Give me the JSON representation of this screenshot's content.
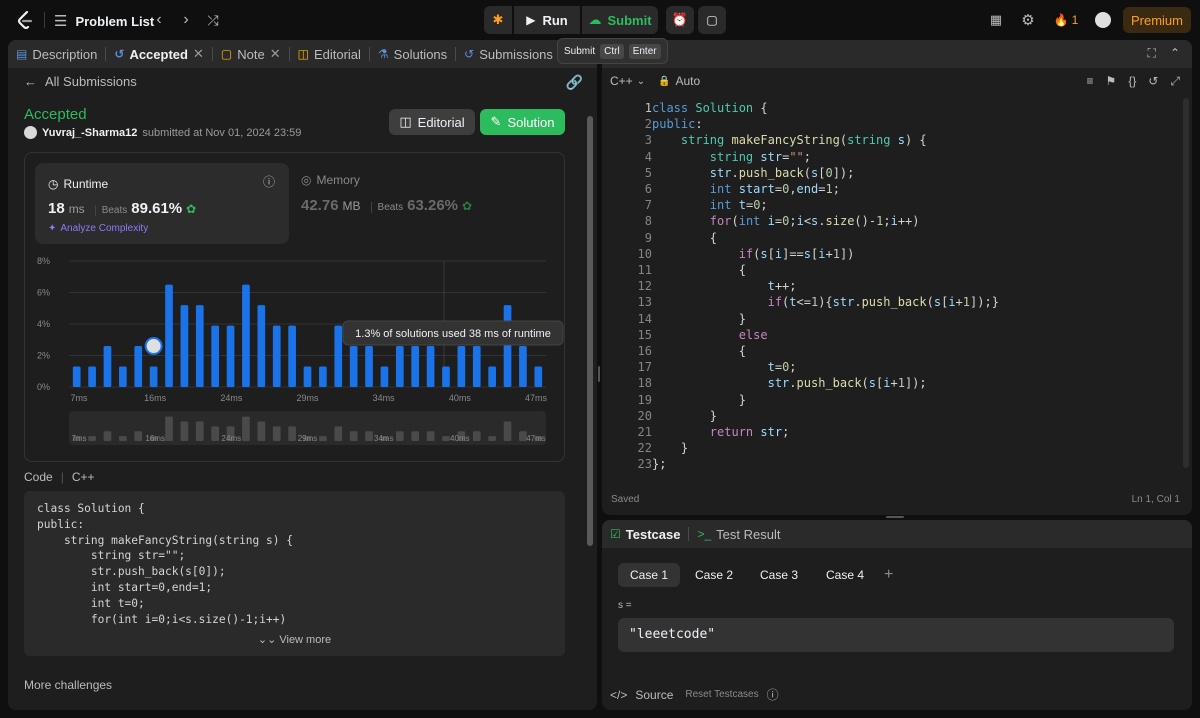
{
  "topbar": {
    "problem_list": "Problem List",
    "run": "Run",
    "submit": "Submit",
    "streak": "1",
    "premium": "Premium"
  },
  "submit_tooltip": {
    "label": "Submit",
    "key1": "Ctrl",
    "key2": "Enter"
  },
  "left_tabs": [
    {
      "label": "Description",
      "icon": "description-icon"
    },
    {
      "label": "Accepted",
      "icon": "history-icon"
    },
    {
      "label": "Note",
      "icon": "note-icon"
    },
    {
      "label": "Editorial",
      "icon": "book-icon"
    },
    {
      "label": "Solutions",
      "icon": "flask-icon"
    },
    {
      "label": "Submissions",
      "icon": "history-icon"
    }
  ],
  "submission": {
    "back": "All Submissions",
    "status": "Accepted",
    "user": "Yuvraj_-Sharma12",
    "submitted_at": "submitted at Nov 01, 2024 23:59",
    "editorial_btn": "Editorial",
    "solution_btn": "Solution"
  },
  "runtime": {
    "title": "Runtime",
    "value": "18",
    "unit": "ms",
    "beats_label": "Beats",
    "beats": "89.61%",
    "analyze": "Analyze Complexity"
  },
  "memory": {
    "title": "Memory",
    "value": "42.76",
    "unit": "MB",
    "beats_label": "Beats",
    "beats": "63.26%"
  },
  "chart_data": {
    "type": "bar",
    "ylabel_ticks": [
      "0%",
      "2%",
      "4%",
      "6%",
      "8%"
    ],
    "ylim": [
      0,
      8
    ],
    "xtick_labels": [
      "7ms",
      "16ms",
      "24ms",
      "29ms",
      "34ms",
      "40ms",
      "47ms"
    ],
    "values": [
      1.3,
      1.3,
      2.6,
      1.3,
      2.6,
      1.3,
      6.5,
      5.2,
      5.2,
      3.9,
      3.9,
      6.5,
      5.2,
      3.9,
      3.9,
      1.3,
      1.3,
      3.9,
      2.6,
      2.6,
      1.3,
      2.6,
      2.6,
      2.6,
      1.3,
      2.6,
      2.6,
      1.3,
      5.2,
      2.6,
      1.3
    ],
    "highlight_index": 5,
    "tooltip": "1.3% of solutions used 38 ms of runtime",
    "grid": true
  },
  "code_section": {
    "label": "Code",
    "lang": "C++",
    "view_more": "View more",
    "more_challenges": "More challenges",
    "lines": [
      "class Solution {",
      "public:",
      "    string makeFancyString(string s) {",
      "        string str=\"\";",
      "        str.push_back(s[0]);",
      "        int start=0,end=1;",
      "        int t=0;",
      "        for(int i=0;i<s.size()-1;i++)"
    ]
  },
  "editor": {
    "lang": "C++",
    "mode": "Auto",
    "status": "Saved",
    "position": "Ln 1, Col 1",
    "line_numbers": [
      "1",
      "2",
      "3",
      "4",
      "5",
      "6",
      "7",
      "8",
      "9",
      "10",
      "11",
      "12",
      "13",
      "14",
      "15",
      "16",
      "17",
      "18",
      "19",
      "20",
      "21",
      "22",
      "23"
    ]
  },
  "testcase": {
    "tab_testcase": "Testcase",
    "tab_result": "Test Result",
    "cases": [
      "Case 1",
      "Case 2",
      "Case 3",
      "Case 4"
    ],
    "param_label": "s =",
    "param_value": "\"leeetcode\"",
    "source": "Source",
    "reset": "Reset Testcases"
  }
}
